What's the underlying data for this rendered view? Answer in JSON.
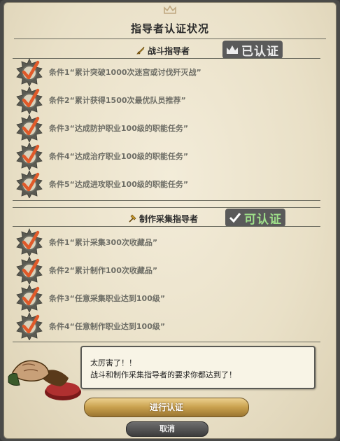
{
  "window": {
    "title": "指导者认证状况"
  },
  "combat": {
    "name": "战斗指导者",
    "status": "已认证",
    "conditions": [
      "条件1“累计突破1000次迷宫或讨伐歼灭战”",
      "条件2“累计获得1500次最优队员推荐”",
      "条件3“达成防护职业100级的职能任务”",
      "条件4“达成治疗职业100级的职能任务”",
      "条件5“达成进攻职业100级的职能任务”"
    ]
  },
  "crafting": {
    "name": "制作采集指导者",
    "status": "可认证",
    "conditions": [
      "条件1“累计采集300次收藏品”",
      "条件2“累计制作100次收藏品”",
      "条件3“任意采集职业达到100级”",
      "条件4“任意制作职业达到100级”"
    ]
  },
  "message": {
    "line1": "太厉害了！！",
    "line2": "战斗和制作采集指导者的要求你都达到了！"
  },
  "buttons": {
    "confirm": "进行认证",
    "cancel": "取消"
  },
  "colors": {
    "accent_gold": "#c8a04d",
    "status_green": "#9fe08a",
    "check_red": "#e05a2a"
  },
  "icons": {
    "crest": "crown-crest-icon",
    "combat": "sword-icon",
    "crafting": "hammer-pickaxe-icon",
    "done": "crown-icon",
    "can": "checkmark-icon",
    "condition": "checked-emblem-icon"
  }
}
